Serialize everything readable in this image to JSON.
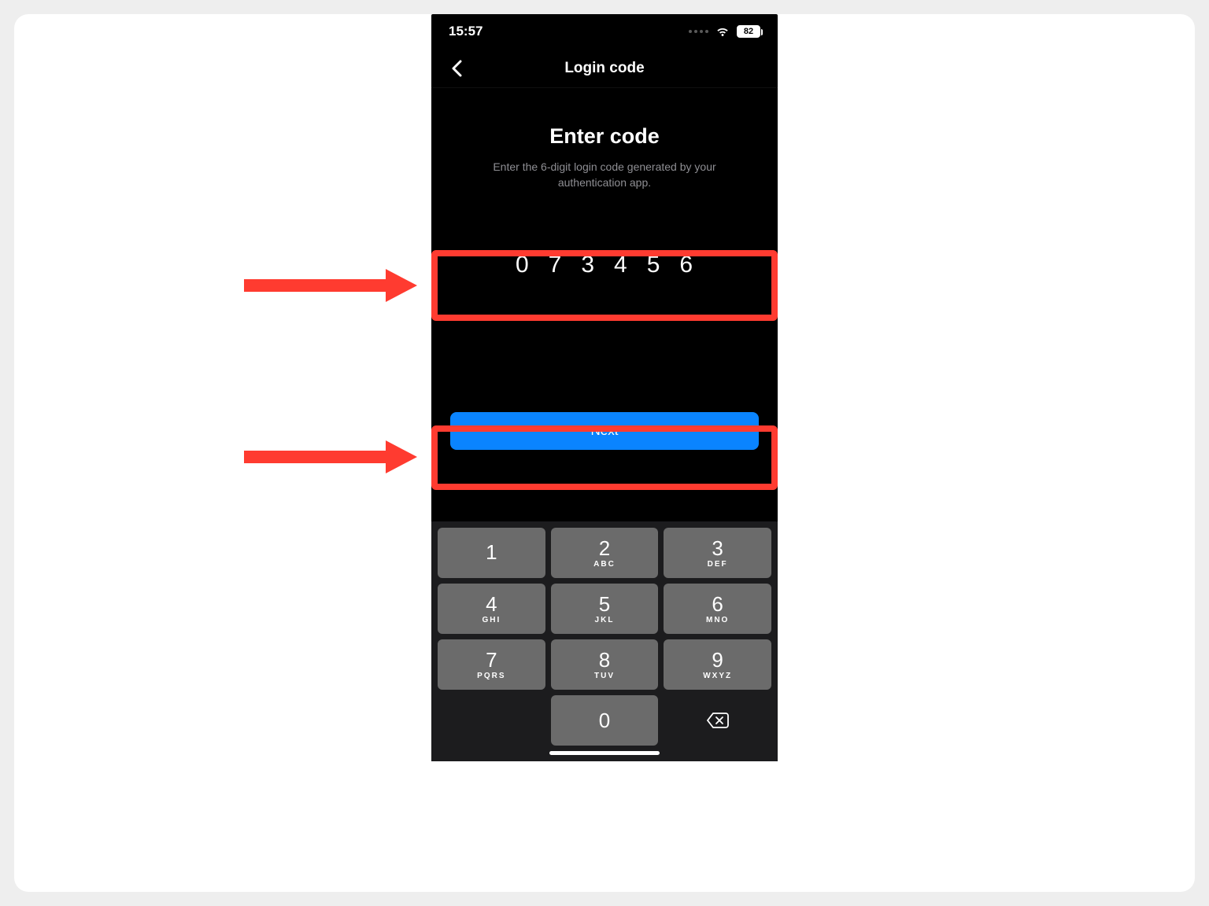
{
  "statusbar": {
    "time": "15:57",
    "battery_percent": "82"
  },
  "header": {
    "title": "Login code"
  },
  "main": {
    "heading": "Enter code",
    "subtext": "Enter the 6-digit login code generated by your authentication app.",
    "code_digits": [
      "0",
      "7",
      "3",
      "4",
      "5",
      "6"
    ],
    "next_label": "Next"
  },
  "keypad": {
    "keys": [
      {
        "num": "1",
        "letters": ""
      },
      {
        "num": "2",
        "letters": "ABC"
      },
      {
        "num": "3",
        "letters": "DEF"
      },
      {
        "num": "4",
        "letters": "GHI"
      },
      {
        "num": "5",
        "letters": "JKL"
      },
      {
        "num": "6",
        "letters": "MNO"
      },
      {
        "num": "7",
        "letters": "PQRS"
      },
      {
        "num": "8",
        "letters": "TUV"
      },
      {
        "num": "9",
        "letters": "WXYZ"
      },
      {
        "num": "0",
        "letters": ""
      }
    ]
  },
  "colors": {
    "accent_highlight": "#ff3b30",
    "primary_button": "#0a84ff"
  }
}
